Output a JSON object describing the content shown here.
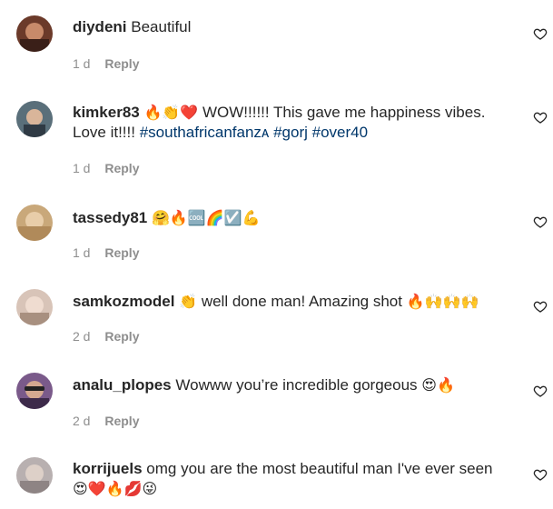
{
  "comments": [
    {
      "username": "diydeni",
      "text": "Beautiful",
      "emojis": "",
      "text2": "",
      "hashtags": [],
      "time": "1 d",
      "reply": "Reply"
    },
    {
      "username": "kimker83",
      "emojis": "🔥👏❤️",
      "text": "WOW!!!!!! This gave me happiness vibes.",
      "text2": "Love it!!!!",
      "hashtags": [
        "#southafricanfanzᴀ",
        "#gorj",
        "#over40"
      ],
      "time": "1 d",
      "reply": "Reply"
    },
    {
      "username": "tassedy81",
      "text": "",
      "emojis": "🤗🔥🆒🌈☑️💪",
      "text2": "",
      "hashtags": [],
      "time": "1 d",
      "reply": "Reply"
    },
    {
      "username": "samkozmodel",
      "emojis": "👏",
      "text": "well done man! Amazing shot",
      "trail": "🔥🙌🙌🙌",
      "text2": "",
      "hashtags": [],
      "time": "2 d",
      "reply": "Reply"
    },
    {
      "username": "analu_plopes",
      "text": "Wowww you’re incredible gorgeous",
      "trail": "😍🔥",
      "text2": "",
      "hashtags": [],
      "time": "2 d",
      "reply": "Reply"
    },
    {
      "username": "korrijuels",
      "text": "omg you are the most beautiful man I've ever seen",
      "text2": "",
      "emojis2": "😍❤️🔥💋😜",
      "hashtags": [],
      "time": "",
      "reply": ""
    }
  ],
  "colors": {
    "username": "#262626",
    "hashtag": "#00376b",
    "meta": "#8e8e8e"
  },
  "icons": {
    "like": "heart-outline-icon"
  }
}
